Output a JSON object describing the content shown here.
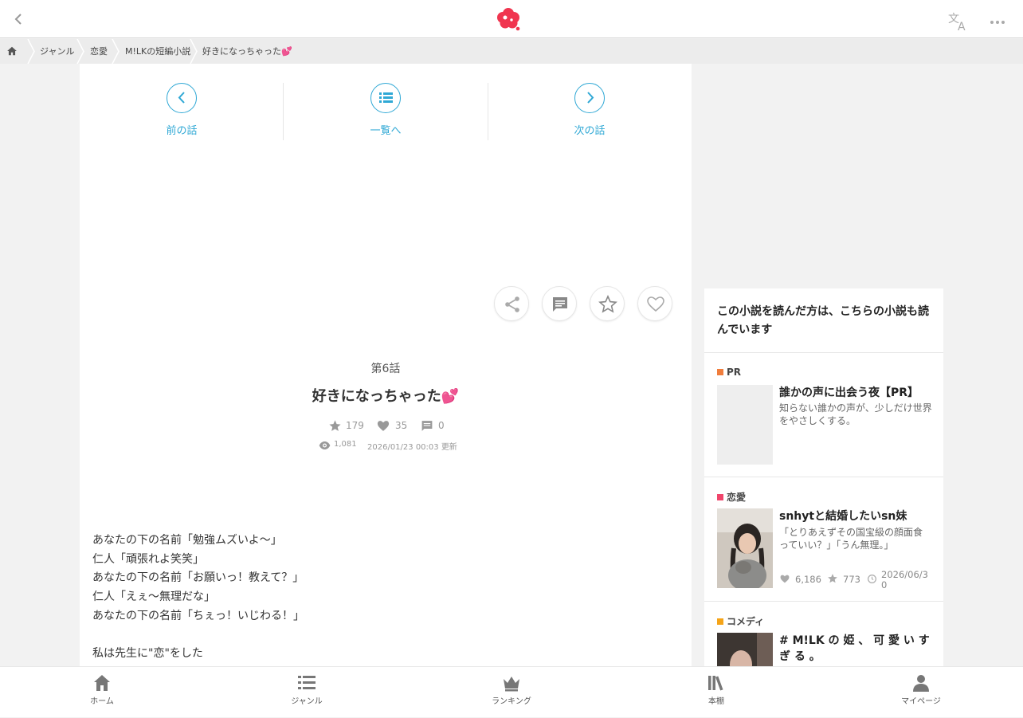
{
  "header": {
    "back_icon": "chevron-left-icon",
    "logo_icon": "flower-logo",
    "translate_icon": "translate-icon",
    "more_icon": "more-dots-icon",
    "brand_color": "#f0354f"
  },
  "breadcrumb": {
    "home_icon": "home-icon",
    "items": [
      "ジャンル",
      "恋愛",
      "M!LKの短編小説",
      "好きになっちゃった💕"
    ]
  },
  "episode_nav": {
    "prev_label": "前の話",
    "list_label": "一覧へ",
    "next_label": "次の話",
    "accent_color": "#2fa8d5"
  },
  "actions": [
    "share-icon",
    "comment-icon",
    "star-icon",
    "heart-icon"
  ],
  "episode": {
    "number": "第6話",
    "title": "好きになっちゃった💕",
    "stars": "179",
    "hearts": "35",
    "comments": "0",
    "views": "1,081",
    "updated": "2026/01/23 00:03 更新"
  },
  "body_lines": [
    "あなたの下の名前「勉強ムズいよ〜」",
    "仁人「頑張れよ笑笑」",
    "あなたの下の名前「お願いっ！教えて？」",
    "仁人「えぇ〜無理だな」",
    "あなたの下の名前「ちぇっ！いじわる！」",
    "",
    "私は先生に\"恋\"をした"
  ],
  "sidebar": {
    "heading": "この小説を読んだ方は、こちらの小説も読んでいます",
    "cards": [
      {
        "category": "PR",
        "category_color": "#f07d3c",
        "title": "誰かの声に出会う夜【PR】",
        "desc": "知らない誰かの声が、少しだけ世界をやさしくする。"
      },
      {
        "category": "恋愛",
        "category_color": "#f0456b",
        "title": "snhytと結婚したいsn妹",
        "desc": "「とりあえずその国宝級の顔面食っていい？」「うん無理。」",
        "likes": "6,186",
        "stars": "773",
        "updated": "2026/06/30"
      },
      {
        "category": "コメディ",
        "category_color": "#f5a418",
        "title": "# M!LK の 姫 、 可 愛 い す ぎ る 。"
      }
    ]
  },
  "bottom_nav": [
    {
      "label": "ホーム",
      "icon": "home-icon"
    },
    {
      "label": "ジャンル",
      "icon": "list-icon"
    },
    {
      "label": "ランキング",
      "icon": "crown-icon"
    },
    {
      "label": "本棚",
      "icon": "bookshelf-icon"
    },
    {
      "label": "マイページ",
      "icon": "user-icon"
    }
  ]
}
